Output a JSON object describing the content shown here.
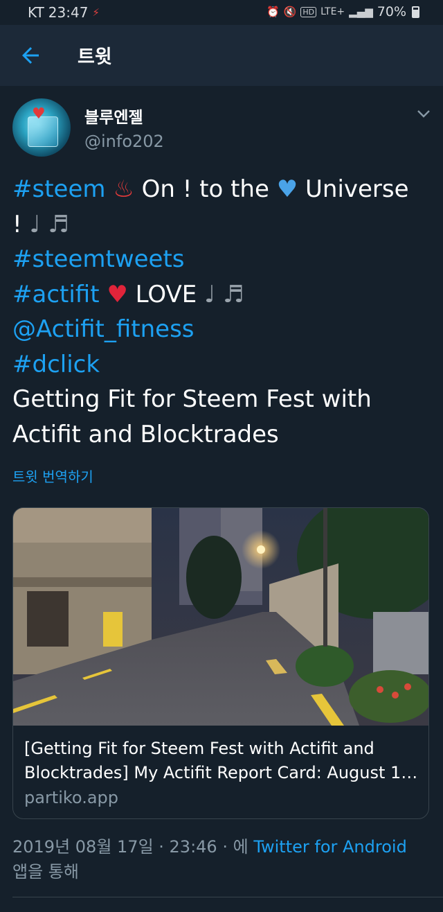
{
  "status_bar": {
    "carrier": "KT",
    "time": "23:47",
    "network": "LTE+",
    "battery": "70%"
  },
  "header": {
    "title": "트윗"
  },
  "tweet": {
    "display_name": "블루엔젤",
    "handle": "@info202",
    "lines": [
      {
        "parts": [
          {
            "t": "#steem",
            "c": "tag"
          },
          {
            "t": " ",
            "c": ""
          },
          {
            "t": "♨",
            "c": "emoji-hotspring"
          },
          {
            "t": " On ! to the ",
            "c": ""
          },
          {
            "t": "♥",
            "c": "emoji-blueheart"
          },
          {
            "t": " Universe",
            "c": ""
          }
        ]
      },
      {
        "parts": [
          {
            "t": "! ",
            "c": ""
          },
          {
            "t": "♩ ♬",
            "c": "notes"
          }
        ]
      },
      {
        "parts": [
          {
            "t": "#steemtweets",
            "c": "tag"
          }
        ]
      },
      {
        "parts": [
          {
            "t": "#actifit",
            "c": "tag"
          },
          {
            "t": " ",
            "c": ""
          },
          {
            "t": "♥",
            "c": "emoji-redheart"
          },
          {
            "t": " LOVE ",
            "c": ""
          },
          {
            "t": "♩ ♬",
            "c": "notes"
          }
        ]
      },
      {
        "parts": [
          {
            "t": "@Actifit_fitness",
            "c": "tag"
          }
        ]
      },
      {
        "parts": [
          {
            "t": "#dclick",
            "c": "tag"
          }
        ]
      },
      {
        "parts": [
          {
            "t": "Getting Fit for Steem Fest with",
            "c": ""
          }
        ]
      },
      {
        "parts": [
          {
            "t": "Actifit and Blocktrades",
            "c": ""
          }
        ]
      }
    ],
    "translate_label": "트윗 번역하기",
    "card": {
      "title_line1": "[Getting Fit for Steem Fest with Actifit and",
      "title_line2": "Blocktrades] My Actifit Report Card: August 1…",
      "domain": "partiko.app"
    },
    "meta": {
      "timestamp": "2019년 08월 17일 · 23:46 · 에 ",
      "source": "Twitter for Android",
      "suffix": "앱을 통해"
    }
  },
  "colors": {
    "background": "#15202b",
    "app_bar": "#1c2938",
    "accent": "#1da1f2",
    "secondary_text": "#8899a6"
  },
  "icons": {
    "back": "arrow-left-icon",
    "caret": "chevron-down-icon"
  }
}
